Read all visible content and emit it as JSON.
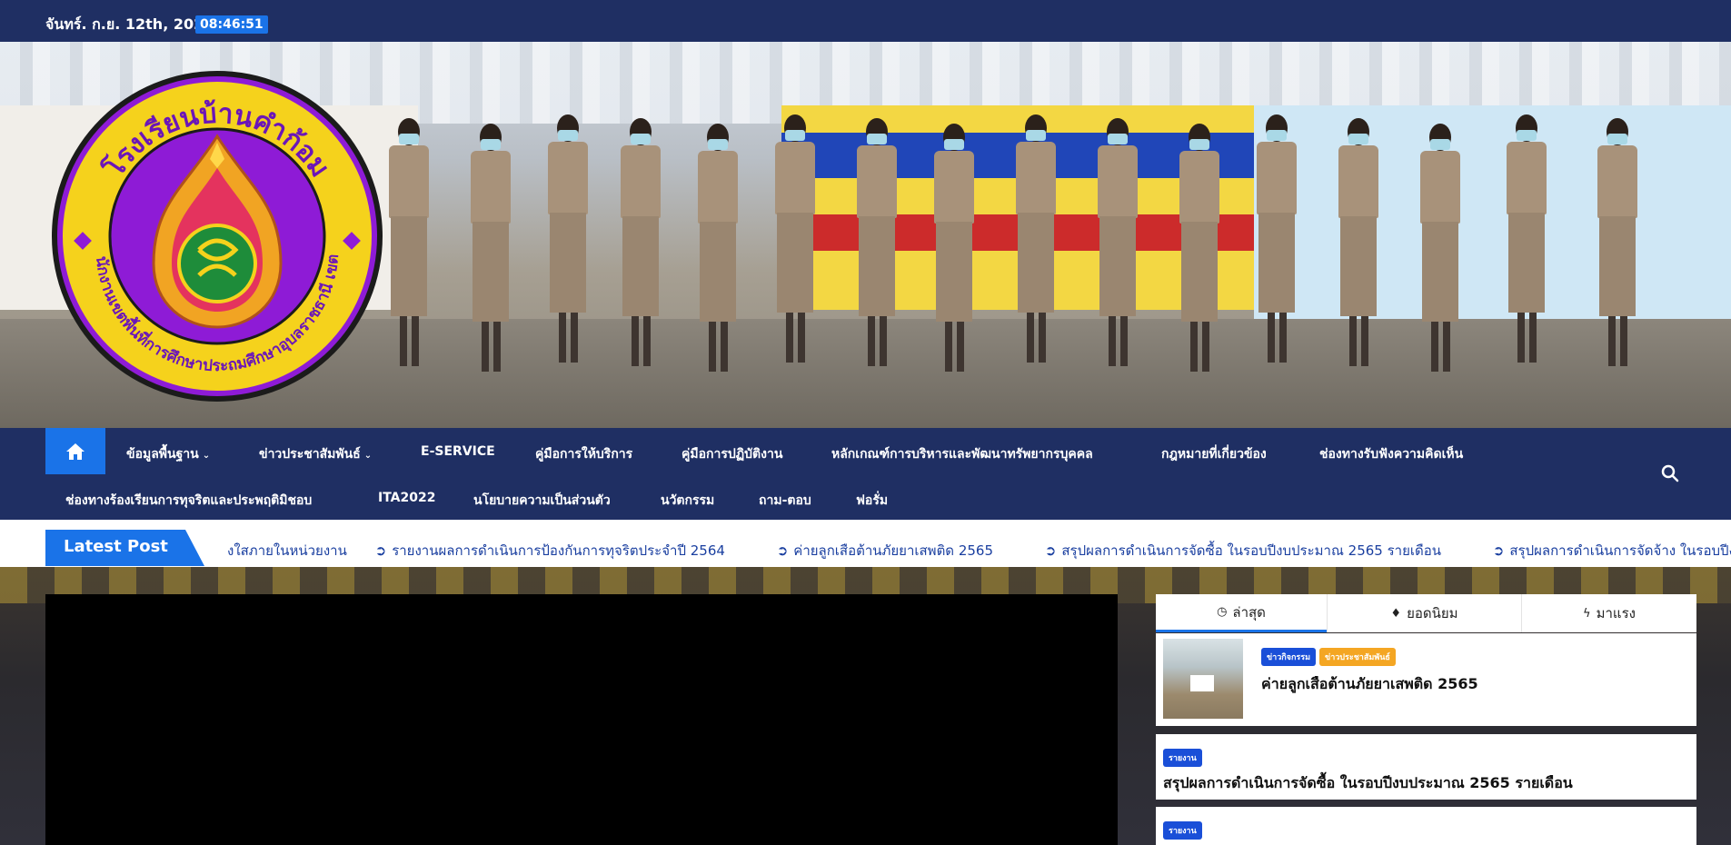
{
  "topbar": {
    "date": "จันทร์. ก.ย. 12th, 2022",
    "time": "08:46:51"
  },
  "logo": {
    "top_text": "โรงเรียนบ้านคำก้อม",
    "bottom_text": "สำนักงานเขตพื้นที่การศึกษาประถมศึกษาอุบลราชธานี เขต ๓",
    "ring_color": "#f5d21c",
    "inner_color": "#8e1bd6"
  },
  "nav": {
    "row1": [
      {
        "label": "ข้อมูลพื้นฐาน",
        "dropdown": true
      },
      {
        "label": "ข่าวประชาสัมพันธ์",
        "dropdown": true
      },
      {
        "label": "E-SERVICE",
        "dropdown": false
      },
      {
        "label": "คู่มือการให้บริการ",
        "dropdown": false
      },
      {
        "label": "คู่มือการปฏิบัติงาน",
        "dropdown": false
      },
      {
        "label": "หลักเกณฑ์การบริหารและพัฒนาทรัพยากรบุคคล",
        "dropdown": false
      },
      {
        "label": "กฎหมายที่เกี่ยวข้อง",
        "dropdown": false
      },
      {
        "label": "ช่องทางรับฟังความคิดเห็น",
        "dropdown": false
      }
    ],
    "row2": [
      {
        "label": "ช่องทางร้องเรียนการทุจริตและประพฤติมิชอบ"
      },
      {
        "label": "ITA2022"
      },
      {
        "label": "นโยบายความเป็นส่วนตัว"
      },
      {
        "label": "นวัตกรรม"
      },
      {
        "label": "ถาม-ตอบ"
      },
      {
        "label": "ฟอรั่ม"
      }
    ],
    "caret": "⌄"
  },
  "ticker": {
    "label": "Latest Post",
    "items": [
      "งใสภายในหน่วยงาน",
      "รายงานผลการดำเนินการป้องกันการทุจริตประจำปี 2564",
      "ค่ายลูกเสือต้านภัยยาเสพติด 2565",
      "สรุปผลการดำเนินการจัดซื้อ ในรอบปีงบประมาณ 2565 รายเดือน",
      "สรุปผลการดำเนินการจัดจ้าง ในรอบปีงบประ"
    ]
  },
  "sidebar": {
    "tabs": [
      {
        "label": "ล่าสุด",
        "icon": "clock-icon",
        "glyph": "◷"
      },
      {
        "label": "ยอดนิยม",
        "icon": "fire-icon",
        "glyph": "♦"
      },
      {
        "label": "มาแรง",
        "icon": "bolt-icon",
        "glyph": "ϟ"
      }
    ],
    "posts": [
      {
        "badges": [
          "ข่าวกิจกรรม",
          "ข่าวประชาสัมพันธ์"
        ],
        "title": "ค่ายลูกเสือต้านภัยยาเสพติด 2565"
      },
      {
        "badges": [
          "รายงาน"
        ],
        "title": "สรุปผลการดำเนินการจัดซื้อ ในรอบปีงบประมาณ 2565 รายเดือน"
      },
      {
        "badges": [
          "รายงาน"
        ],
        "title": ""
      }
    ]
  },
  "colors": {
    "navy": "#1f2f63",
    "accent": "#1a73e8",
    "orange_badge": "#f4a623"
  }
}
